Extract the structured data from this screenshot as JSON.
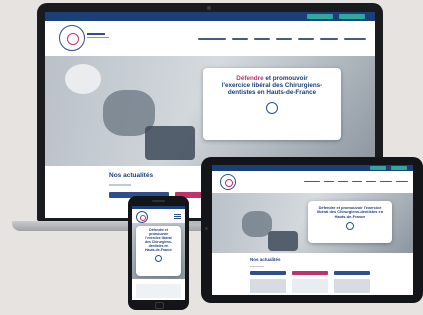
{
  "hero": {
    "line1_accent": "Défendre",
    "line1_rest": " et promouvoir",
    "line2": "l'exercice libéral des Chirurgiens-",
    "line3": "dentistes en Hauts-de-France"
  },
  "tablet_hero": {
    "line1": "Défendre et promouvoir l'exercice",
    "line2": "libéral des Chirurgiens-dentistes en",
    "line3": "Hauts-de-France"
  },
  "phone_hero": {
    "line1": "Défendre et",
    "line2": "promouvoir",
    "line3": "l'exercice libéral",
    "line4": "des Chirurgiens-",
    "line5": "dentistes en",
    "line6": "Hauts-de-France"
  },
  "news": {
    "title": "Nos actualités"
  },
  "colors": {
    "brand_blue": "#1c3f7a",
    "accent_pink": "#c0326c",
    "accent_teal": "#2fa7a2",
    "background": "#e6e3e1"
  },
  "icons": [
    "logo-icon",
    "webcam-icon",
    "home-button-icon"
  ]
}
